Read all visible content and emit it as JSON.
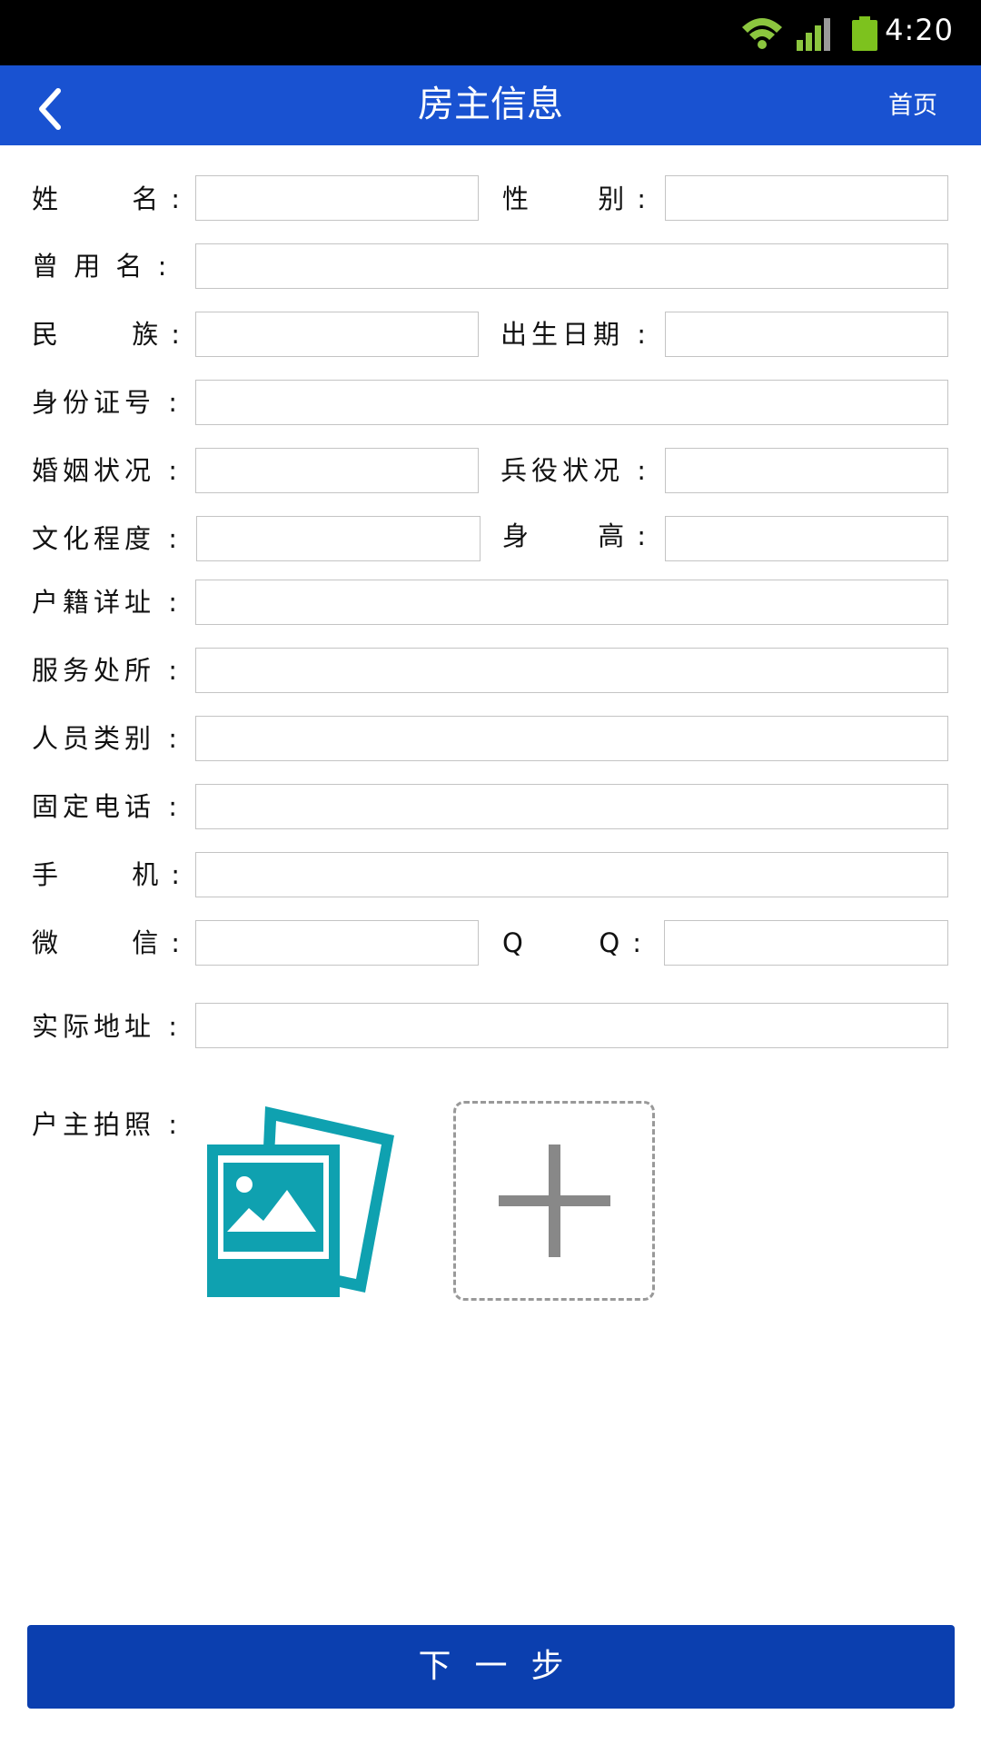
{
  "status_bar": {
    "time": "4:20",
    "icons": [
      "wifi-icon",
      "signal-icon",
      "battery-icon"
    ],
    "wifi_color": "#8cc63f",
    "battery_color": "#7dc21e"
  },
  "header": {
    "title": "房主信息",
    "home_label": "首页",
    "back_icon": "chevron-left-icon",
    "background": "#1952d1"
  },
  "form": {
    "name": {
      "label_first": "姓",
      "label_last": "名",
      "colon": ":",
      "value": ""
    },
    "gender": {
      "label_first": "性",
      "label_last": "别",
      "colon": ":",
      "value": ""
    },
    "former_name": {
      "label": "曾 用 名 :",
      "value": ""
    },
    "ethnicity": {
      "label_first": "民",
      "label_last": "族",
      "colon": ":",
      "value": ""
    },
    "birth_date": {
      "label": "出生日期 :",
      "value": ""
    },
    "id_number": {
      "label": "身份证号 :",
      "value": ""
    },
    "marital_status": {
      "label": "婚姻状况 :",
      "value": ""
    },
    "military_status": {
      "label": "兵役状况 :",
      "value": ""
    },
    "education": {
      "label": "文化程度 :",
      "value": ""
    },
    "height": {
      "label_first": "身",
      "label_last": "高",
      "colon": ":",
      "value": ""
    },
    "household_address": {
      "label": "户籍详址 :",
      "value": ""
    },
    "workplace": {
      "label": "服务处所 :",
      "value": ""
    },
    "person_type": {
      "label": "人员类别 :",
      "value": ""
    },
    "landline": {
      "label": "固定电话 :",
      "value": ""
    },
    "mobile": {
      "label_first": "手",
      "label_last": "机",
      "colon": ":",
      "value": ""
    },
    "wechat": {
      "label_first": "微",
      "label_last": "信",
      "colon": ":",
      "value": ""
    },
    "qq": {
      "label_first": "Q",
      "label_last": "Q",
      "colon": ":",
      "value": ""
    },
    "actual_address": {
      "label": "实际地址 :",
      "value": ""
    },
    "photo": {
      "label": "户主拍照 :",
      "placeholder_icon": "photo-gallery-icon",
      "add_icon": "plus-icon",
      "icon_color": "#0fa1b0"
    }
  },
  "next_button": {
    "label": "下一步",
    "background": "#0b3faf"
  }
}
